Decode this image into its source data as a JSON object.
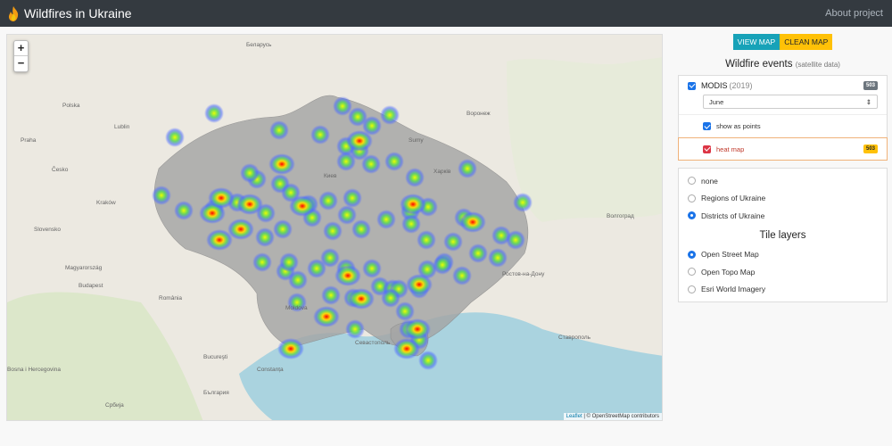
{
  "navbar": {
    "title": "Wildfires in Ukraine",
    "about": "About project"
  },
  "buttons": {
    "view_map": "VIEW MAP",
    "clean_map": "CLEAN MAP"
  },
  "events": {
    "title": "Wildfire events",
    "subtitle": "(satellite data)",
    "modis_label": "MODIS",
    "modis_year": "(2019)",
    "modis_count": "503",
    "month_selected": "June",
    "show_points_label": "show as points",
    "heat_map_label": "heat map",
    "heat_map_count": "503"
  },
  "boundaries": [
    {
      "label": "none",
      "selected": false
    },
    {
      "label": "Regions of Ukraine",
      "selected": false
    },
    {
      "label": "Districts of Ukraine",
      "selected": true
    }
  ],
  "tile_layers": {
    "title": "Tile layers",
    "items": [
      {
        "label": "Open Street Map",
        "selected": true
      },
      {
        "label": "Open Topo Map",
        "selected": false
      },
      {
        "label": "Esri World Imagery",
        "selected": false
      }
    ]
  },
  "map": {
    "attribution_leaflet": "Leaflet",
    "attribution_osm": "| © OpenStreetMap contributors",
    "labels": [
      "Беларусь",
      "Polska",
      "Киев",
      "Харків",
      "Воронеж",
      "Волгоград",
      "Ростов-на-Дону",
      "Moldova",
      "România",
      "Magyarország",
      "Slovensko",
      "Česko",
      "Србија",
      "България",
      "Ставрополь",
      "Севастополь",
      "Bosna i Hercegovina",
      "Lublin",
      "Kraków",
      "Budapest",
      "Bucureşti",
      "Constanța",
      "Sumy",
      "Praha"
    ]
  },
  "colors": {
    "navbar": "#343a40",
    "accent": "#17a2b8",
    "warning": "#ffc107",
    "heat_hot": "#ff0000",
    "heat_cool": "#4b6bff"
  }
}
